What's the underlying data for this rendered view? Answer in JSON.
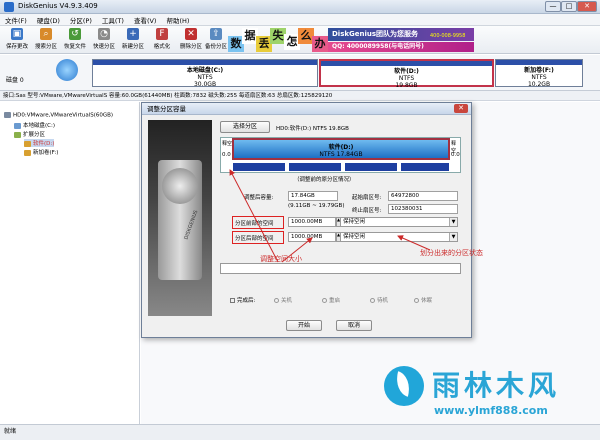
{
  "app": {
    "title": "DiskGenius V4.9.3.409",
    "window_buttons": [
      "—",
      "□",
      "✕"
    ]
  },
  "menu": [
    "文件(F)",
    "硬盘(D)",
    "分区(P)",
    "工具(T)",
    "查看(V)",
    "帮助(H)"
  ],
  "toolbar": [
    {
      "label": "保存更改",
      "icon": "save-icon",
      "color": "#3a78c8"
    },
    {
      "label": "搜索分区",
      "icon": "search-icon",
      "color": "#d88a2a"
    },
    {
      "label": "恢复文件",
      "icon": "recover-icon",
      "color": "#4a9a3a"
    },
    {
      "label": "快速分区",
      "icon": "quick-partition-icon",
      "color": "#8a8a8a"
    },
    {
      "label": "新建分区",
      "icon": "new-partition-icon",
      "color": "#3a6ab8"
    },
    {
      "label": "格式化",
      "icon": "format-icon",
      "color": "#c04040"
    },
    {
      "label": "删除分区",
      "icon": "delete-icon",
      "color": "#c03030"
    },
    {
      "label": "备份分区",
      "icon": "backup-icon",
      "color": "#5a8ac0"
    }
  ],
  "banner": {
    "chars": [
      "数",
      "据",
      "丢",
      "失",
      "怎",
      "么",
      "办"
    ],
    "team": "DiskGenius团队为您服务",
    "qq": "QQ: 4000089958(与电话同号)",
    "phone": "400-008-9958"
  },
  "disk_bar": {
    "label": "磁盘 0",
    "partitions": [
      {
        "name": "本地磁盘(C:)",
        "fs": "NTFS",
        "size": "30.0GB"
      },
      {
        "name": "软件(D:)",
        "fs": "NTFS",
        "size": "19.8GB"
      },
      {
        "name": "新加卷(F:)",
        "fs": "NTFS",
        "size": "10.2GB"
      }
    ]
  },
  "info_bar": "接口:Sas  型号:VMware,VMwareVirtualS  容量:60.0GB(61440MB)  柱面数:7832  磁头数:255  每道扇区数:63  总扇区数:125829120",
  "tree": [
    {
      "label": "HD0:VMware,VMwareVirtualS(60GB)",
      "level": 0
    },
    {
      "label": "本地磁盘(C:)",
      "level": 1
    },
    {
      "label": "扩展分区",
      "level": 1
    },
    {
      "label": "软件(D:)",
      "level": 2
    },
    {
      "label": "新加卷(F:)",
      "level": 2
    }
  ],
  "status_bar": "就绪",
  "dialog": {
    "title": "调整分区容量",
    "close": "✕",
    "select_button": "选择分区",
    "current": "HD0:软件(D:) NTFS 19.8GB",
    "art_text": "DISKGENIUS",
    "pbar": {
      "left_label": "释空",
      "left_value": "0.0",
      "right_label": "释空",
      "right_value": "0.0",
      "main_name": "软件(D:)",
      "main_detail": "NTFS 17.84GB"
    },
    "hint": "（调整前的原分区情况）",
    "fields": {
      "after_size_label": "调整后容量:",
      "after_size": "17.84GB",
      "after_size_sub": "(9.11GB ~ 19.79GB)",
      "start_sector_label": "起始扇区号:",
      "start_sector": "64972800",
      "end_sector_label": "终止扇区号:",
      "end_sector": "102380031",
      "before_label": "分区前部的空间",
      "before_value": "1000.00MB",
      "before_select": "保持空闲",
      "after_label": "分区后部的空间",
      "after_value": "1000.00MB",
      "after_select": "保持空闲"
    },
    "complete_label": "完成后:",
    "radios": [
      "关机",
      "重启",
      "待机",
      "休眠"
    ],
    "start_button": "开始",
    "cancel_button": "取消"
  },
  "annotations": {
    "resize": "调整空间大小",
    "state": "划分出来的分区状态"
  },
  "watermark": {
    "title": "雨林木风",
    "url": "www.ylmf888.com"
  },
  "colors": {
    "annotation_red": "#cc2a2a",
    "partition_blue": "#1d6fc4",
    "watermark": "#2aa5d6"
  }
}
